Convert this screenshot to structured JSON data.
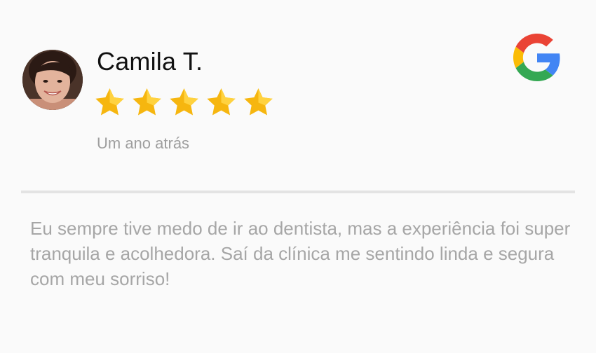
{
  "review": {
    "author_name": "Camila T.",
    "rating": 5,
    "max_rating": 5,
    "time_ago": "Um ano atrás",
    "text": "Eu sempre tive medo de ir ao dentista, mas a experiência foi super tranquila e acolhedora. Saí da clínica me sentindo linda e segura com meu sorriso!",
    "source_icon": "google-g-icon"
  },
  "colors": {
    "star": "#f6b60f",
    "star_highlight": "#ffd23f",
    "google_blue": "#4285F4",
    "google_red": "#EA4335",
    "google_yellow": "#FBBC05",
    "google_green": "#34A853",
    "muted_text": "#9e9e9e",
    "divider": "#e3e3e3"
  }
}
